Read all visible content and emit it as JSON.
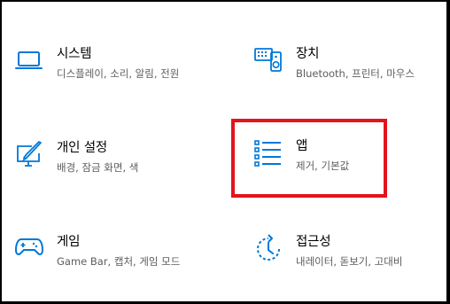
{
  "colors": {
    "accent": "#0078d7",
    "highlight": "#e3141c",
    "desc_text": "#5d5d5d"
  },
  "tiles": [
    {
      "title": "시스템",
      "desc": "디스플레이, 소리, 알림, 전원",
      "icon": "laptop-icon"
    },
    {
      "title": "장치",
      "desc": "Bluetooth, 프린터, 마우스",
      "icon": "devices-icon"
    },
    {
      "title": "개인 설정",
      "desc": "배경, 잠금 화면, 색",
      "icon": "personalization-icon"
    },
    {
      "title": "앱",
      "desc": "제거, 기본값",
      "icon": "apps-list-icon"
    },
    {
      "title": "게임",
      "desc": "Game Bar, 캡처, 게임 모드",
      "icon": "gamepad-icon"
    },
    {
      "title": "접근성",
      "desc": "내레이터, 돋보기, 고대비",
      "icon": "ease-of-access-icon"
    }
  ]
}
